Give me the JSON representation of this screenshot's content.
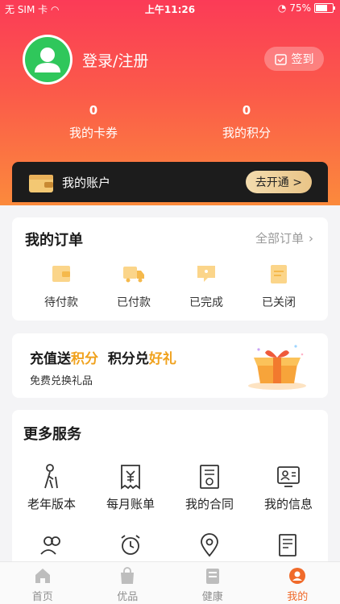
{
  "status": {
    "carrier": "无 SIM 卡",
    "time": "上午11:26",
    "battery": "75%",
    "battery_level": 0.75
  },
  "profile": {
    "login_label": "登录/注册",
    "signin_label": "签到"
  },
  "stats": [
    {
      "value": "0",
      "label": "我的卡券"
    },
    {
      "value": "0",
      "label": "我的积分"
    }
  ],
  "account": {
    "title": "我的账户",
    "button": "去开通 >"
  },
  "orders": {
    "title": "我的订单",
    "all_label": "全部订单",
    "items": [
      {
        "label": "待付款",
        "icon": "wallet-icon"
      },
      {
        "label": "已付款",
        "icon": "truck-icon"
      },
      {
        "label": "已完成",
        "icon": "message-icon"
      },
      {
        "label": "已关闭",
        "icon": "clipboard-icon"
      }
    ]
  },
  "promo": {
    "part1": "充值送",
    "hl1": "积分",
    "part2": "积分兑",
    "hl2": "好礼",
    "subtitle": "免费兑换礼品"
  },
  "services": {
    "title": "更多服务",
    "items": [
      {
        "label": "老年版本",
        "icon": "elderly-icon"
      },
      {
        "label": "每月账单",
        "icon": "bill-icon"
      },
      {
        "label": "我的合同",
        "icon": "contract-icon"
      },
      {
        "label": "我的信息",
        "icon": "profile-card-icon"
      },
      {
        "label": "",
        "icon": "users-icon"
      },
      {
        "label": "",
        "icon": "alarm-clock-icon"
      },
      {
        "label": "",
        "icon": "location-pin-icon"
      },
      {
        "label": "",
        "icon": "document-icon"
      }
    ]
  },
  "tabs": [
    {
      "label": "首页",
      "icon": "home-icon"
    },
    {
      "label": "优品",
      "icon": "shopping-bag-icon"
    },
    {
      "label": "健康",
      "icon": "health-icon"
    },
    {
      "label": "我的",
      "icon": "user-icon",
      "active": true
    }
  ],
  "colors": {
    "accent": "#f06a2a",
    "gold": "#f0a21e",
    "hero_top": "#fb3b57",
    "hero_bottom": "#fb8a3c"
  }
}
